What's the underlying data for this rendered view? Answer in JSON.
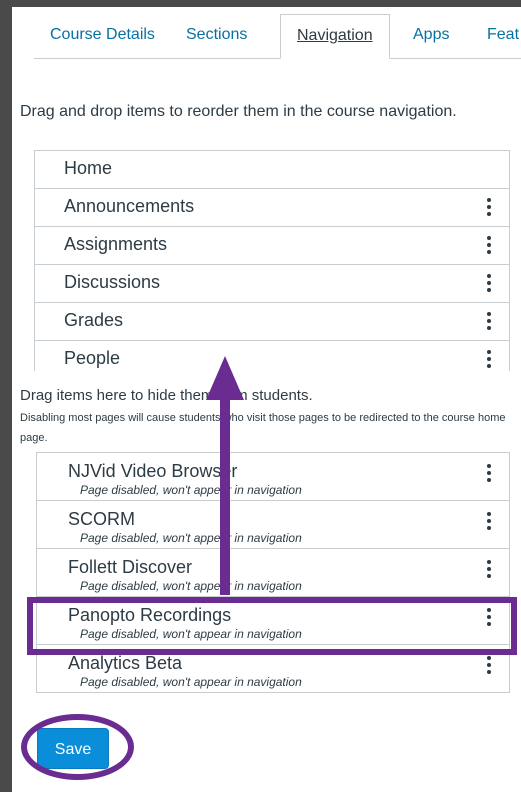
{
  "tabs": [
    "Course Details",
    "Sections",
    "Navigation",
    "Apps",
    "Feat"
  ],
  "active_tab": "Navigation",
  "instructions": "Drag and drop items to reorder them in the course navigation.",
  "enabled_items": [
    {
      "label": "Home"
    },
    {
      "label": "Announcements"
    },
    {
      "label": "Assignments"
    },
    {
      "label": "Discussions"
    },
    {
      "label": "Grades"
    },
    {
      "label": "People"
    }
  ],
  "hidden_section": {
    "title": "Drag items here to hide them from students.",
    "note": "Disabling most pages will cause students who visit those pages to be redirected to the course home page."
  },
  "disabled_items": [
    {
      "label": "NJVid Video Browser",
      "status": "Page disabled, won't appear in navigation"
    },
    {
      "label": "SCORM",
      "status": "Page disabled, won't appear in navigation"
    },
    {
      "label": "Follett Discover",
      "status": "Page disabled, won't appear in navigation"
    },
    {
      "label": "Panopto Recordings",
      "status": "Page disabled, won't appear in navigation"
    },
    {
      "label": "Analytics Beta",
      "status": "Page disabled, won't appear in navigation"
    }
  ],
  "save_label": "Save",
  "colors": {
    "accent": "#6b2c91",
    "link": "#0770a3",
    "button": "#0b8ed9"
  }
}
